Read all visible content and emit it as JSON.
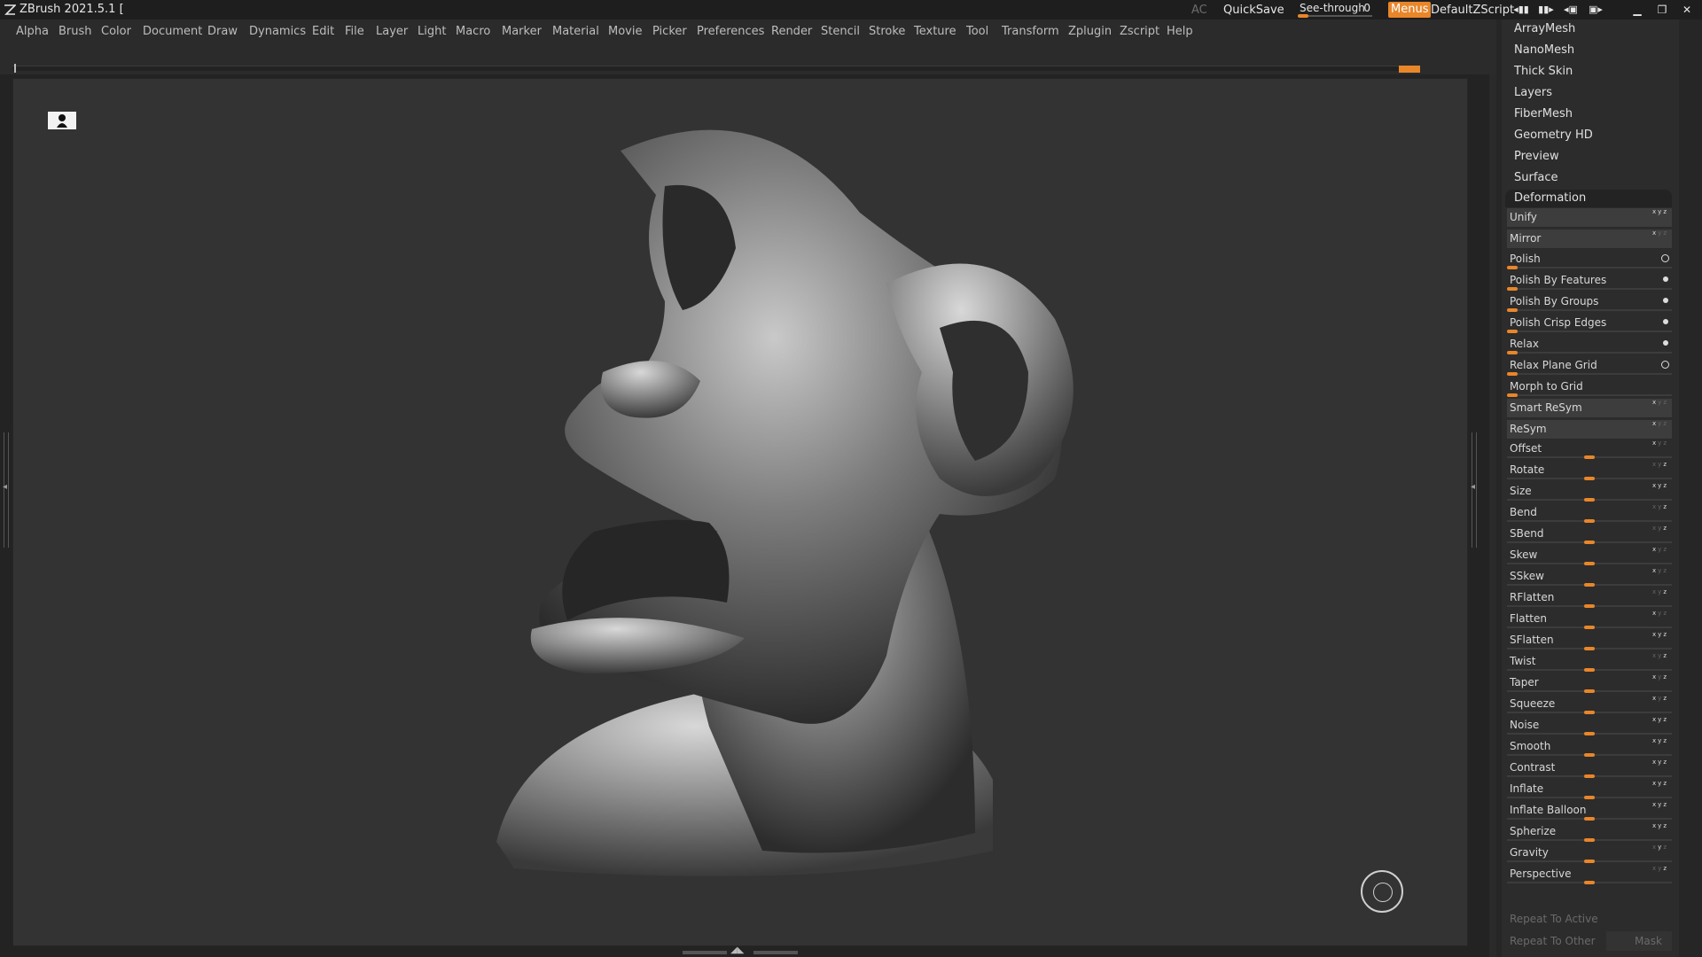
{
  "titlebar": {
    "app_title": "ZBrush 2021.5.1 [",
    "ac_label": "AC",
    "quicksave_label": "QuickSave",
    "seethrough_label": "See-through",
    "seethrough_value": "0",
    "menus_label": "Menus",
    "script_label": "DefaultZScript",
    "accent_color": "#e8862a"
  },
  "menubar": {
    "items": [
      "Alpha",
      "Brush",
      "Color",
      "Document",
      "Draw",
      "Dynamics",
      "Edit",
      "File",
      "Layer",
      "Light",
      "Macro",
      "Marker",
      "Material",
      "Movie",
      "Picker",
      "Preferences",
      "Render",
      "Stencil",
      "Stroke",
      "Texture",
      "Tool",
      "Transform",
      "Zplugin",
      "Zscript",
      "Help"
    ]
  },
  "panel": {
    "subpalettes": [
      "ArrayMesh",
      "NanoMesh",
      "Thick Skin",
      "Layers",
      "FiberMesh",
      "Geometry HD",
      "Preview",
      "Surface"
    ],
    "deformation_title": "Deformation",
    "buttons": {
      "unify": "Unify",
      "mirror": "Mirror",
      "smart_resym": "Smart ReSym",
      "resym": "ReSym"
    },
    "polish_sliders": [
      "Polish",
      "Polish By Features",
      "Polish By Groups",
      "Polish Crisp Edges",
      "Relax",
      "Relax Plane Grid",
      "Morph to Grid"
    ],
    "deform_sliders": [
      "Offset",
      "Rotate",
      "Size",
      "Bend",
      "SBend",
      "Skew",
      "SSkew",
      "RFlatten",
      "Flatten",
      "SFlatten",
      "Twist",
      "Taper",
      "Squeeze",
      "Noise",
      "Smooth",
      "Contrast",
      "Inflate",
      "Inflate Balloon",
      "Spherize",
      "Gravity",
      "Perspective"
    ],
    "repeat_active": "Repeat To Active",
    "repeat_other": "Repeat To Other",
    "mask": "Mask"
  }
}
